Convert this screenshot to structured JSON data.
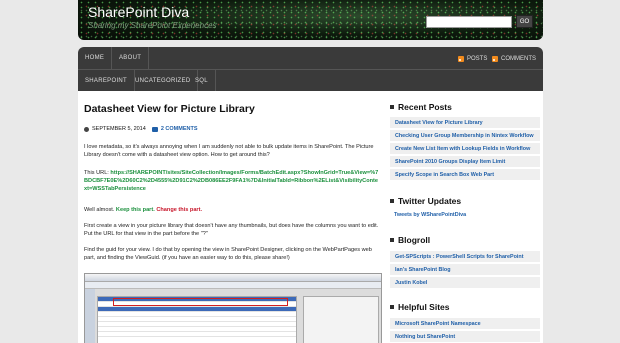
{
  "header": {
    "site_title": "SharePoint Diva",
    "tagline": "Sharing my SharePoint Experiences",
    "search_placeholder": "",
    "search_button": "GO"
  },
  "nav": {
    "row1": [
      "HOME",
      "ABOUT"
    ],
    "row2": [
      "SHAREPOINT",
      "UNCATEGORIZED",
      "SQL"
    ],
    "feeds": [
      "POSTS",
      "COMMENTS"
    ]
  },
  "post": {
    "title": "Datasheet View for Picture Library",
    "date": "SEPTEMBER 5, 2014",
    "comments": "2 COMMENTS",
    "p1": "I love metadata, so it's always annoying when I am suddenly not able to bulk update items in SharePoint. The Picture Library doesn't come with a datasheet view option. How to get around this?",
    "p2_prefix": "This URL: ",
    "p2_url": "https://SHAREPOINT/sites/SiteCollection/Images/Forms/BatchEdit.aspx?ShowInGrid=True&View=%7BDCBF7E0E%2D60C2%2D4555%2D91C2%2DB086EE2F9FA1%7D&InitialTabId=Ribbon%2EList&VisibilityContext=WSSTabPersistence",
    "p3_prefix": "Well almost. ",
    "p3_keep": "Keep this part.",
    "p3_change": "Change this part.",
    "p4": "First create a view in your picture library that doesn't have any thumbnails, but does have the columns you want to edit. Put the URL for that view in the part before the \"?\"",
    "p5": "Find the guid for your view. I do that by opening the view in SharePoint Designer, clicking on the WebPartPages web part, and finding the ViewGuid. (if you have an easier way to do this, please share!)"
  },
  "sidebar": {
    "recent_posts": {
      "heading": "Recent Posts",
      "items": [
        "Datasheet View for Picture Library",
        "Checking User Group Membership in Nintex Workflow",
        "Create New List Item with Lookup Fields in Workflow",
        "SharePoint 2010 Groups Display Item Limit",
        "Specify Scope in Search Box Web Part"
      ]
    },
    "twitter": {
      "heading": "Twitter Updates",
      "link": "Tweets by WSharePointDiva"
    },
    "blogroll": {
      "heading": "Blogroll",
      "items": [
        "Get-SPScripts : PowerShell Scripts for SharePoint",
        "Ian's SharePoint Blog",
        "Justin Kobel"
      ]
    },
    "helpful": {
      "heading": "Helpful Sites",
      "items": [
        "Microsoft SharePoint Namespace",
        "Nothing but SharePoint"
      ]
    }
  },
  "colors": {
    "link": "#1f5fa8",
    "url_green": "#1a8f3c",
    "change_red": "#c8172b",
    "nav_bg": "#3a3a3a",
    "rss": "#f28b1d"
  }
}
